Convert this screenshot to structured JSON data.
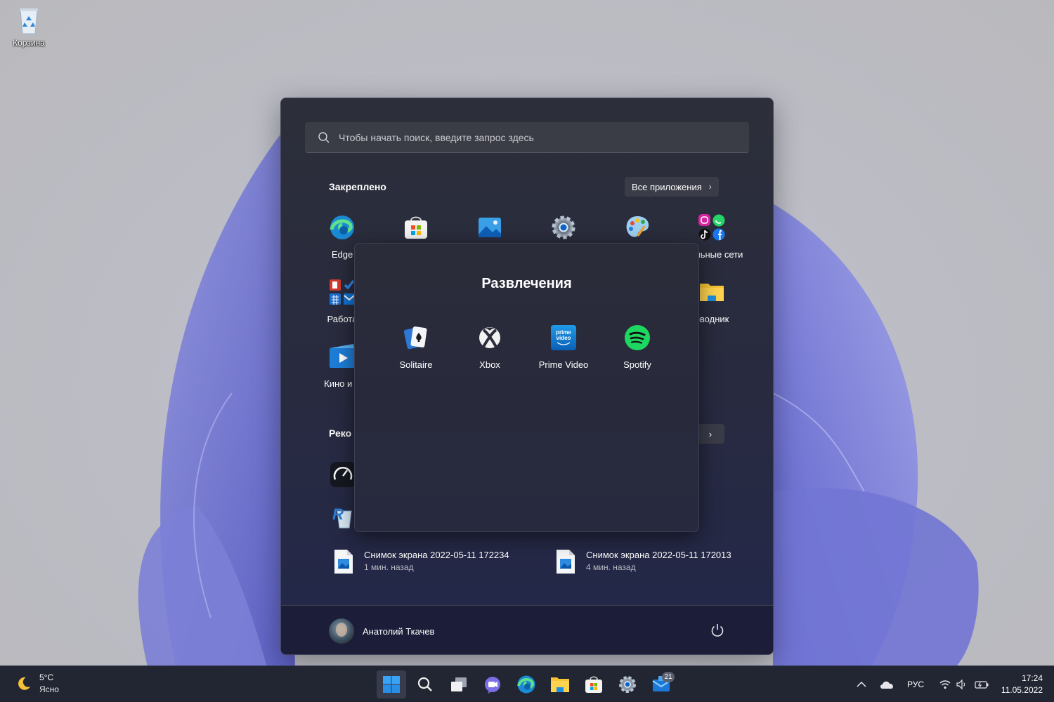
{
  "desktop": {
    "recycle_bin_label": "Корзина"
  },
  "start_menu": {
    "search": {
      "placeholder": "Чтобы начать поиск, введите запрос здесь"
    },
    "pinned": {
      "title": "Закреплено",
      "all_apps_label": "Все приложения",
      "apps": [
        {
          "label": "Edge",
          "icon": "edge-icon"
        },
        {
          "label": "",
          "icon": "store-icon"
        },
        {
          "label": "",
          "icon": "photos-icon"
        },
        {
          "label": "",
          "icon": "settings-icon"
        },
        {
          "label": "",
          "icon": "paint-icon"
        },
        {
          "label": "иальные сети",
          "icon": "social-folder-icon"
        },
        {
          "label": "Работа",
          "icon": "work-folder-icon"
        },
        {
          "label": "оводник",
          "icon": "explorer-icon"
        },
        {
          "label": "Кино и Т",
          "icon": "movies-icon"
        }
      ]
    },
    "recommended": {
      "title": "Реко",
      "more_label": "›",
      "items": [
        {
          "name": "Снимок экрана 2022-05-11 172234",
          "time": "1 мин. назад"
        },
        {
          "name": "Снимок экрана 2022-05-11 172013",
          "time": "4 мин. назад"
        }
      ]
    },
    "user": {
      "name": "Анатолий Ткачев"
    }
  },
  "folder": {
    "title": "Развлечения",
    "apps": [
      {
        "label": "Solitaire",
        "icon": "solitaire-icon"
      },
      {
        "label": "Xbox",
        "icon": "xbox-icon"
      },
      {
        "label": "Prime Video",
        "icon": "prime-video-icon"
      },
      {
        "label": "Spotify",
        "icon": "spotify-icon"
      }
    ],
    "prime_text": "prime video"
  },
  "taskbar": {
    "weather": {
      "temp": "5°C",
      "condition": "Ясно"
    },
    "mail_badge": "21",
    "language": "РУС",
    "time": "17:24",
    "date": "11.05.2022"
  }
}
